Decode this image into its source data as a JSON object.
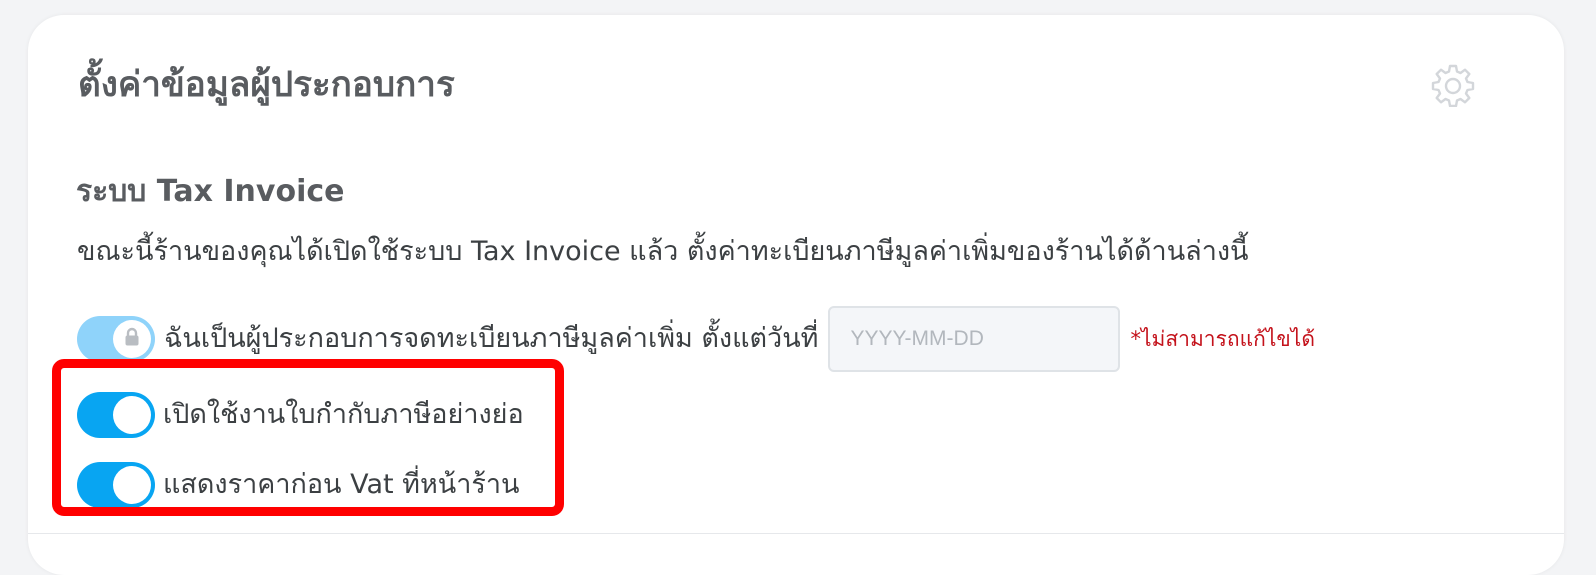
{
  "card": {
    "title": "ตั้งค่าข้อมูลผู้ประกอบการ",
    "settings_icon": "gear-icon"
  },
  "tax_invoice": {
    "section_title": "ระบบ Tax Invoice",
    "description": "ขณะนี้ร้านของคุณได้เปิดใช้ระบบ Tax Invoice แล้ว ตั้งค่าทะเบียนภาษีมูลค่าเพิ่มของร้านได้ด้านล่างนี้",
    "vat_registered": {
      "label": "ฉันเป็นผู้ประกอบการจดทะเบียนภาษีมูลค่าเพิ่ม ตั้งแต่วันที่",
      "enabled": true,
      "locked": true,
      "lock_icon": "lock-icon",
      "date_value": "",
      "date_placeholder": "YYYY-MM-DD",
      "note": "*ไม่สามารถแก้ไขได้"
    },
    "abbreviated_invoice": {
      "label": "เปิดใช้งานใบกำกับภาษีอย่างย่อ",
      "enabled": true
    },
    "show_price_before_vat": {
      "label": "แสดงราคาก่อน Vat ที่หน้าร้าน",
      "enabled": true
    }
  },
  "colors": {
    "toggle_on": "#08a5f2",
    "toggle_locked": "#8fd3fa",
    "note_red": "#c4121b",
    "highlight": "#ff0000"
  }
}
